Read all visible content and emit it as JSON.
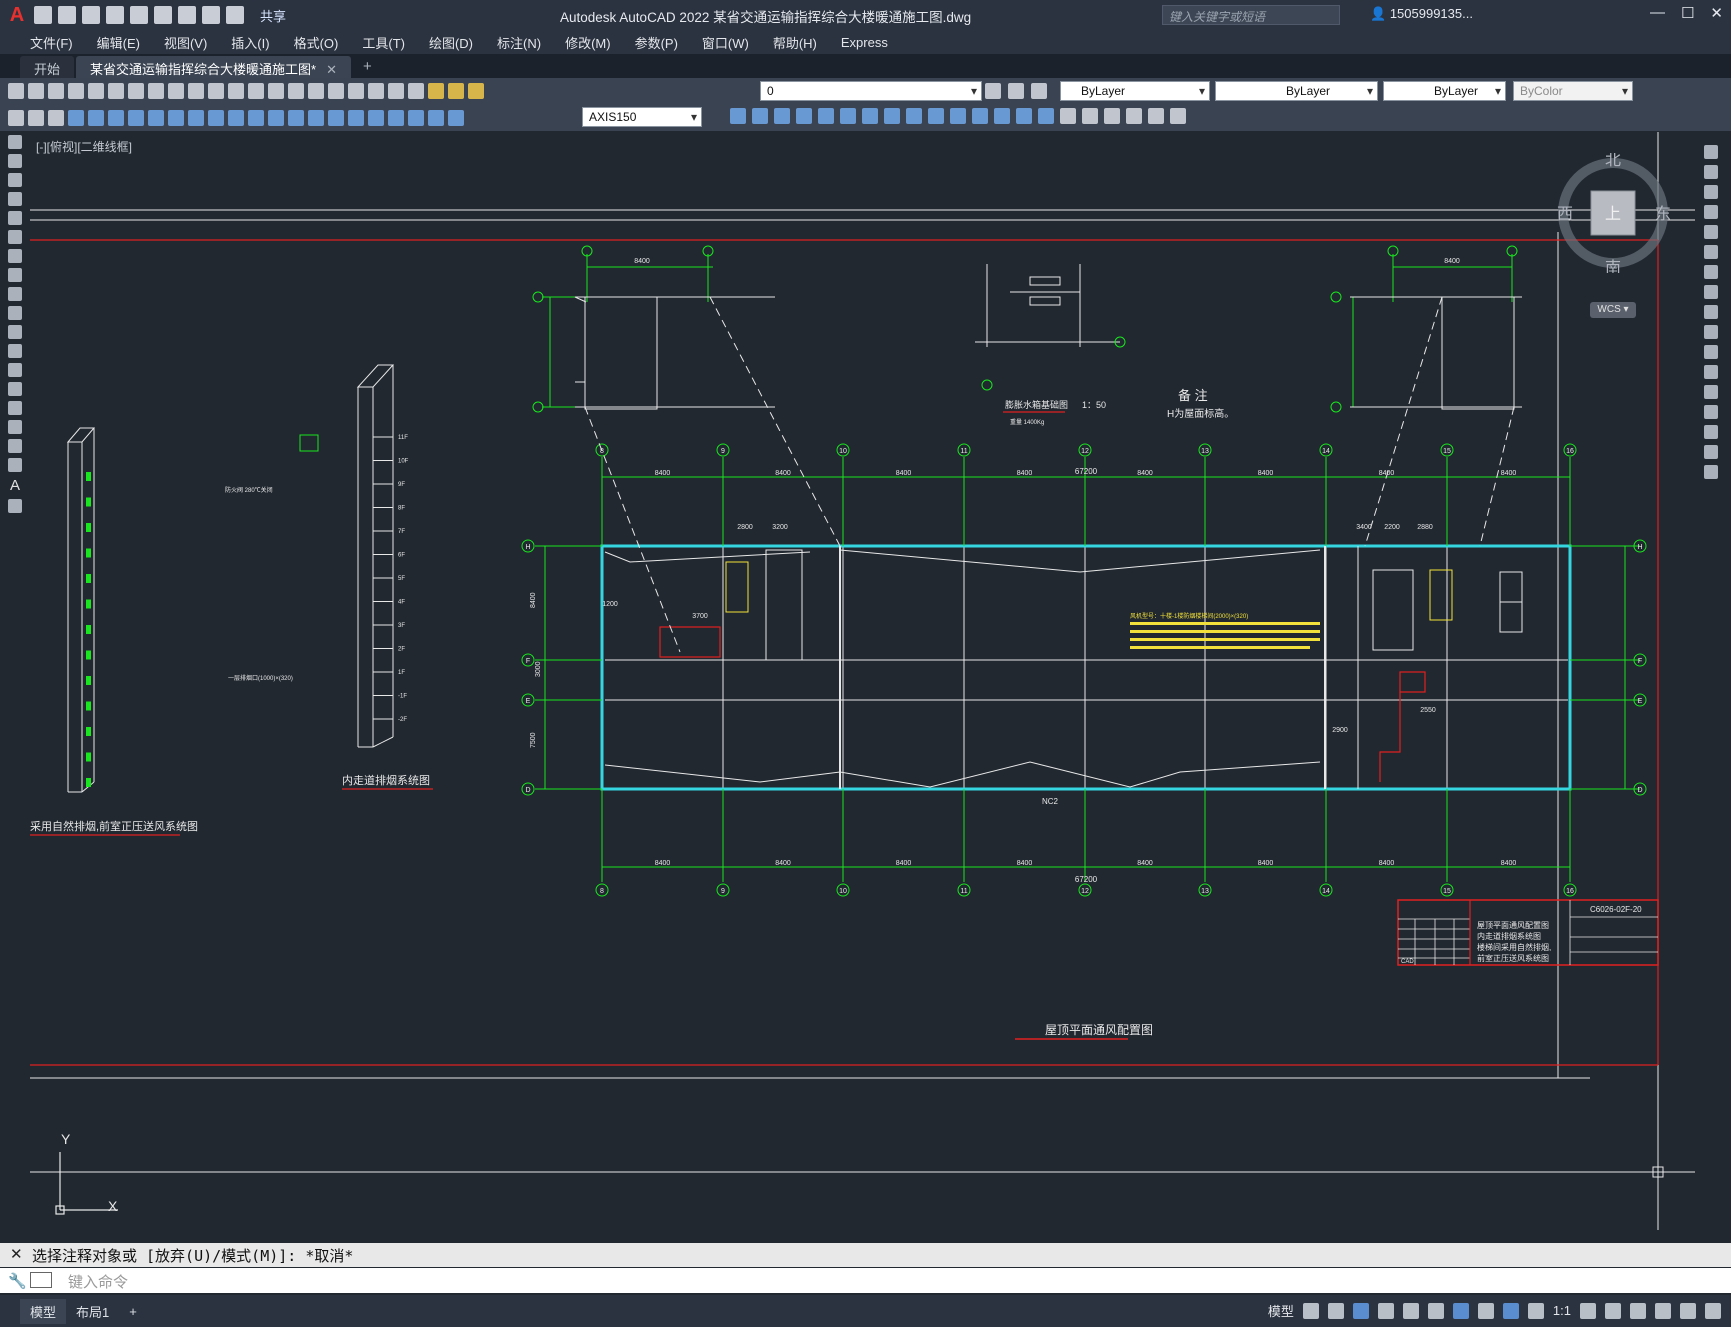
{
  "app": {
    "title": "Autodesk AutoCAD 2022    某省交通运输指挥综合大楼暖通施工图.dwg",
    "share_label": "共享",
    "search_placeholder": "键入关键字或短语",
    "user": "1505999135...",
    "logo": "A"
  },
  "menu": [
    "文件(F)",
    "编辑(E)",
    "视图(V)",
    "插入(I)",
    "格式(O)",
    "工具(T)",
    "绘图(D)",
    "标注(N)",
    "修改(M)",
    "参数(P)",
    "窗口(W)",
    "帮助(H)",
    "Express"
  ],
  "tabs": [
    {
      "label": "开始"
    },
    {
      "label": "某省交通运输指挥综合大楼暖通施工图*"
    }
  ],
  "toolbar": {
    "layer_value": "0",
    "color_value": "ByLayer",
    "linetype_value": "ByLayer",
    "lineweight_value": "ByLayer",
    "plotstyle_value": "ByColor",
    "dimstyle_value": "AXIS150"
  },
  "viewport": {
    "label": "[-][俯视][二维线框]",
    "compass": {
      "north": "北",
      "south": "南",
      "east": "东",
      "west": "西",
      "top": "上",
      "wcs": "WCS"
    },
    "ucs": {
      "x": "X",
      "y": "Y"
    }
  },
  "drawing": {
    "titles": {
      "roof_plan": "屋顶平面通风配置图",
      "corridor_smoke": "内走道排烟系统图",
      "stair_natural": "采用自然排烟,前室正压送风系统图",
      "water_tank": "膨胀水箱基础图",
      "water_tank_scale": "1：50",
      "water_tank_note": "重量 1400Kg",
      "remarks_title": "备 注",
      "remarks_text": "H为屋面标高。"
    },
    "axis_labels_top": [
      "8",
      "9",
      "10",
      "11",
      "12",
      "13",
      "14",
      "15",
      "16"
    ],
    "axis_labels_side": [
      "H",
      "F",
      "E",
      "D"
    ],
    "dims_top": [
      "8400",
      "8400",
      "8400",
      "8400",
      "8400",
      "8400",
      "8400",
      "8400"
    ],
    "total_dim": "67200",
    "side_dims": [
      "8400",
      "3000",
      "7500"
    ],
    "detail_dims": {
      "d1": "2800",
      "d2": "3200",
      "d3": "3400",
      "d4": "2200",
      "d5": "2880",
      "d6": "2550",
      "d7": "2900",
      "d8": "1200",
      "d9": "3700",
      "d10": "8400"
    },
    "annotation": "风机型号：十楼-1楼防烟楼梯间(2000)×(320)",
    "title_block": {
      "drawing_no": "C6026-02F-20",
      "lines": [
        "屋顶平面通风配置图",
        "内走道排烟系统图",
        "楼梯间采用自然排烟,",
        "前室正压送风系统图"
      ],
      "cad": "CAD"
    },
    "riser_levels": [
      "11F",
      "10F",
      "9F",
      "8F",
      "7F",
      "6F",
      "5F",
      "4F",
      "3F",
      "2F",
      "1F",
      "-1F",
      "-2F"
    ],
    "fire_damper": "防火阀 280℃关闭",
    "duct_note": "一层排烟口(1000)×(320)"
  },
  "command": {
    "history": "选择注释对象或 [放弃(U)/模式(M)]: *取消*",
    "prompt_placeholder": "键入命令"
  },
  "status": {
    "tabs": [
      "模型",
      "布局1"
    ],
    "model_label": "模型",
    "scale": "1:1"
  },
  "colors": {
    "bg": "#212830",
    "green": "#19e61e",
    "cyan": "#35d6e0",
    "red": "#e02020",
    "white": "#e8e8e8",
    "yellow": "#f2e13a"
  }
}
